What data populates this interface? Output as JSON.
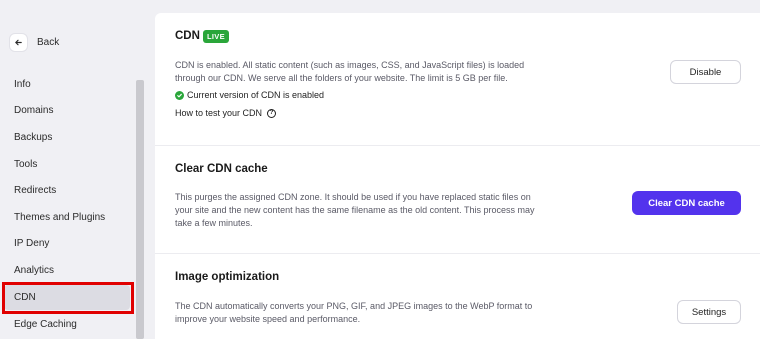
{
  "sidebar": {
    "back_label": "Back",
    "items": [
      {
        "label": "Info"
      },
      {
        "label": "Domains"
      },
      {
        "label": "Backups"
      },
      {
        "label": "Tools"
      },
      {
        "label": "Redirects"
      },
      {
        "label": "Themes and Plugins"
      },
      {
        "label": "IP Deny"
      },
      {
        "label": "Analytics"
      },
      {
        "label": "CDN",
        "active": true
      },
      {
        "label": "Edge Caching"
      }
    ]
  },
  "cdn": {
    "title": "CDN",
    "badge": "LIVE",
    "description": "CDN is enabled. All static content (such as images, CSS, and JavaScript files) is loaded through our CDN. We serve all the folders of your website. The limit is 5 GB per file.",
    "status": "Current version of CDN is enabled",
    "test_link": "How to test your CDN",
    "disable_label": "Disable"
  },
  "clear_cache": {
    "title": "Clear CDN cache",
    "description": "This purges the assigned CDN zone. It should be used if you have replaced static files on your site and the new content has the same filename as the old content. This process may take a few minutes.",
    "button_label": "Clear CDN cache"
  },
  "image_opt": {
    "title": "Image optimization",
    "description": "The CDN automatically converts your PNG, GIF, and JPEG images to the WebP format to improve your website speed and performance.",
    "button_label": "Settings"
  },
  "colors": {
    "accent": "#5333ed",
    "live": "#2aa63a",
    "highlight": "#e00000"
  }
}
